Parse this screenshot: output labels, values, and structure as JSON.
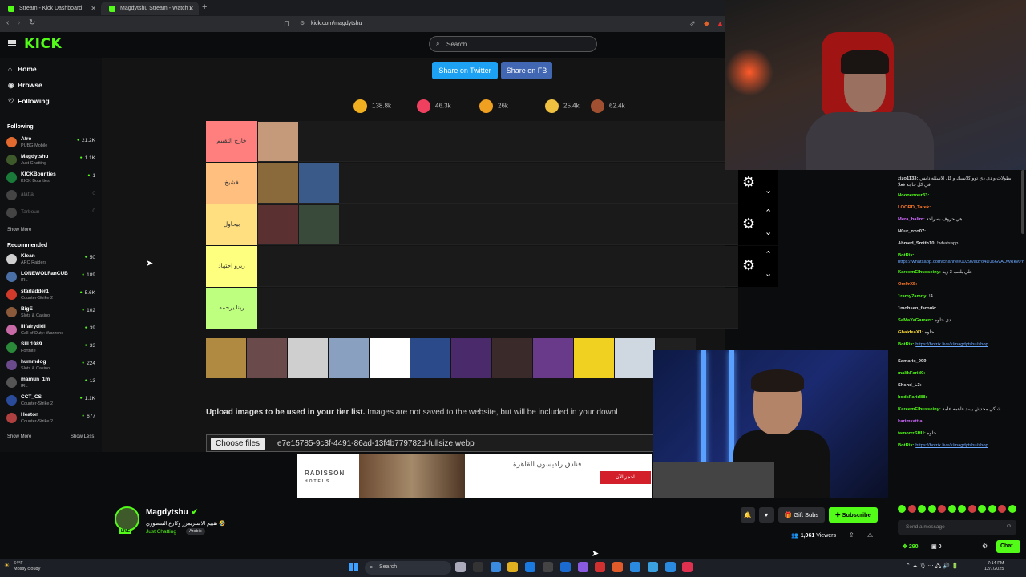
{
  "browser": {
    "tabs": [
      {
        "label": "Stream - Kick Dashboard"
      },
      {
        "label": "Magdytshu Stream - Watch L"
      }
    ],
    "url": "kick.com/magdytshu"
  },
  "header": {
    "logo": "KICK",
    "search_placeholder": "Search"
  },
  "sidebar": {
    "nav": [
      {
        "label": "Home",
        "icon": "home-icon"
      },
      {
        "label": "Browse",
        "icon": "compass-icon"
      },
      {
        "label": "Following",
        "icon": "heart-icon"
      }
    ],
    "following_title": "Following",
    "following": [
      {
        "name": "Atro",
        "game": "PUBG Mobile",
        "viewers": "21.2K",
        "color": "#e36a2e"
      },
      {
        "name": "Magdytshu",
        "game": "Just Chatting",
        "viewers": "1.1K",
        "color": "#3e5a2a"
      },
      {
        "name": "KICKBounties",
        "game": "KICK Bounties",
        "viewers": "1",
        "color": "#1a7a3a"
      },
      {
        "name": "alattal",
        "game": "",
        "viewers": "0",
        "color": "#444"
      },
      {
        "name": "Tarboun",
        "game": "",
        "viewers": "0",
        "color": "#444"
      }
    ],
    "show_more": "Show More",
    "recommended_title": "Recommended",
    "recommended": [
      {
        "name": "Klean",
        "game": "ARC Raiders",
        "viewers": "50",
        "color": "#cfcfcf"
      },
      {
        "name": "LONEWOLFanCUB",
        "game": "IRL",
        "viewers": "189",
        "color": "#4a6fa5"
      },
      {
        "name": "starladder1",
        "game": "Counter-Strike 2",
        "viewers": "5.6K",
        "color": "#d13a2a"
      },
      {
        "name": "BigE",
        "game": "Slots & Casino",
        "viewers": "102",
        "color": "#8a5a3a"
      },
      {
        "name": "lilfairydidi",
        "game": "Call of Duty: Warzone",
        "viewers": "39",
        "color": "#c76aa5"
      },
      {
        "name": "SIIL1989",
        "game": "Fortnite",
        "viewers": "33",
        "color": "#2a8a3a"
      },
      {
        "name": "hummdog",
        "game": "Slots & Casino",
        "viewers": "224",
        "color": "#6a4a8a"
      },
      {
        "name": "mamun_1m",
        "game": "IRL",
        "viewers": "13",
        "color": "#555"
      },
      {
        "name": "CCT_CS",
        "game": "Counter-Strike 2",
        "viewers": "1.1K",
        "color": "#2a4a9a"
      },
      {
        "name": "Heaton",
        "game": "Counter-Strike 2",
        "viewers": "677",
        "color": "#b04040"
      }
    ],
    "show_more_2": "Show More",
    "show_less": "Show Less"
  },
  "stream": {
    "share_twitter": "Share on Twitter",
    "share_fb": "Share on FB",
    "reactions": [
      {
        "count": "138.8k",
        "color": "#f0b020"
      },
      {
        "count": "46.3k",
        "color": "#f04060"
      },
      {
        "count": "26k",
        "color": "#f0a020"
      },
      {
        "count": "25.4k",
        "color": "#f0c040"
      },
      {
        "count": "62.4k",
        "color": "#a05030"
      }
    ],
    "tiers": [
      {
        "label": "خارج التقييم",
        "color": "#ff7f7f"
      },
      {
        "label": "فشيخ",
        "color": "#ffbf7f"
      },
      {
        "label": "بيحاول",
        "color": "#ffdf7f"
      },
      {
        "label": "زيرو اجتهاد",
        "color": "#ffff7f"
      },
      {
        "label": "ربنا يرحمه",
        "color": "#bfff7f"
      }
    ],
    "upload_bold": "Upload images to be used in your tier list.",
    "upload_rest": " Images are not saved to the website, but will be included in your downl",
    "choose_files": "Choose files",
    "file_name": "e7e15785-9c3f-4491-86ad-13f4b779782d-fullsize.webp"
  },
  "ad": {
    "brand": "RADISSON",
    "brand_sub": "HOTELS",
    "headline": "فنادق راديسون القاهرة",
    "cta": "احجز الآن"
  },
  "channel": {
    "name": "Magdytshu",
    "title": "تقييم الاستريمرز وكارع السطوري 🤣",
    "category": "Just Chatting",
    "language": "Arabic",
    "live": "LIVE",
    "gift_subs": "Gift Subs",
    "subscribe": "Subscribe",
    "viewers": "1,061",
    "viewers_label": "Viewers"
  },
  "chat": {
    "messages": [
      {
        "user": "zizo1133:",
        "text": "بطولات و دي دي توو كلاسيك و كل الاسئله دايس في كل حاجه فعلا",
        "color": "#ddd"
      },
      {
        "user": "Noonenour33:",
        "text": "",
        "color": "#53fc18"
      },
      {
        "user": "LOORD_Tarek:",
        "text": "",
        "color": "#ff7a2a"
      },
      {
        "user": "Mera_halim:",
        "text": "هي حروف بصراحة",
        "color": "#d06aff"
      },
      {
        "user": "N0ur_nxo07:",
        "text": "",
        "color": "#ddd"
      },
      {
        "user": "Ahmed_Smith10:",
        "text": "!whatsapp",
        "color": "#ddd"
      },
      {
        "user": "BotRix:",
        "text": "https://whatsapp.com/channel/0029Vaizro4DJ6GvADwRkv0Y",
        "color": "#53fc18",
        "link": true
      },
      {
        "user": "KareemElhusseiny:",
        "text": "علي بلعب 3 زيه",
        "color": "#53fc18"
      },
      {
        "user": "Om9rX5:",
        "text": "",
        "color": "#ff7a2a"
      },
      {
        "user": "1ramy7amdy:",
        "text": "!4",
        "color": "#53fc18"
      },
      {
        "user": "1mohsen_farouk:",
        "text": "",
        "color": "#ddd"
      },
      {
        "user": "SaMaYaGamerr:",
        "text": "دي حلوه",
        "color": "#53fc18"
      },
      {
        "user": "GhaideaX1:",
        "text": "حلوه",
        "color": "#ffdf3a"
      },
      {
        "user": "BotRix:",
        "text": "https://botrix.live/k/magdytshu/shop",
        "color": "#53fc18",
        "link": true
      },
      {
        "user": "Samarix_999:",
        "text": "",
        "color": "#ddd"
      },
      {
        "user": "malikFarid0:",
        "text": "",
        "color": "#53fc18"
      },
      {
        "user": "Shshd_L3:",
        "text": "",
        "color": "#ddd"
      },
      {
        "user": "bodsFarid88:",
        "text": "",
        "color": "#53fc18"
      },
      {
        "user": "KareemElhusseiny:",
        "text": "شاكي محدش يسد فاهمه عامة",
        "color": "#53fc18"
      },
      {
        "user": "karimxattia:",
        "text": "",
        "color": "#d06aff"
      },
      {
        "user": "tamorrrSHU:",
        "text": "حلوه",
        "color": "#53fc18"
      },
      {
        "user": "BotRix:",
        "text": "https://botrix.live/k/magdytshu/shop",
        "color": "#53fc18",
        "link": true
      }
    ],
    "input_placeholder": "Send a message",
    "points": "290",
    "points2": "0",
    "chat_button": "Chat"
  },
  "taskbar": {
    "weather_temp": "64°F",
    "weather_desc": "Mostly cloudy",
    "search": "Search",
    "time": "7:14 PM",
    "date": "12/7/2025"
  }
}
